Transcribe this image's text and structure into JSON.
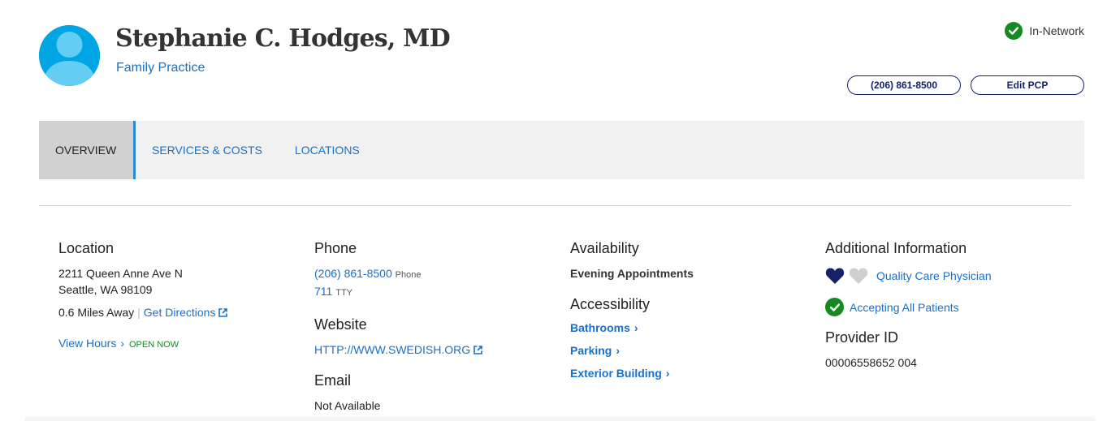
{
  "provider": {
    "name": "Stephanie C. Hodges, MD",
    "specialty": "Family Practice",
    "network_status": "In-Network"
  },
  "actions": {
    "phone_label": "(206) 861-8500",
    "edit_pcp_label": "Edit PCP"
  },
  "tabs": [
    {
      "label": "OVERVIEW",
      "active": true
    },
    {
      "label": "SERVICES & COSTS",
      "active": false
    },
    {
      "label": "LOCATIONS",
      "active": false
    }
  ],
  "location": {
    "heading": "Location",
    "address_line1": "2211 Queen Anne Ave N",
    "address_line2": "Seattle, WA 98109",
    "distance": "0.6 Miles Away",
    "directions_label": "Get Directions",
    "hours_label": "View Hours",
    "open_status": "OPEN NOW"
  },
  "phone": {
    "heading": "Phone",
    "number": "(206) 861-8500",
    "number_type": "Phone",
    "tty_number": "711",
    "tty_type": "TTY"
  },
  "website": {
    "heading": "Website",
    "url": "HTTP://WWW.SWEDISH.ORG"
  },
  "email": {
    "heading": "Email",
    "value": "Not Available"
  },
  "availability": {
    "heading": "Availability",
    "value": "Evening Appointments"
  },
  "accessibility": {
    "heading": "Accessibility",
    "items": [
      "Bathrooms",
      "Parking",
      "Exterior Building"
    ]
  },
  "additional": {
    "heading": "Additional Information",
    "quality_label": "Quality Care Physician",
    "quality_hearts_filled": 1,
    "quality_hearts_total": 2,
    "accepting_label": "Accepting All Patients",
    "provider_id_heading": "Provider ID",
    "provider_id": "00006558652 004"
  },
  "colors": {
    "link": "#1a6fc9",
    "navy": "#14216b",
    "success": "#158a23",
    "avatar": "#63cdf4",
    "tab_active_border": "#2a86d6"
  },
  "icons": [
    "avatar-icon",
    "check-circle-icon",
    "external-link-icon",
    "chevron-right-icon",
    "heart-icon"
  ]
}
